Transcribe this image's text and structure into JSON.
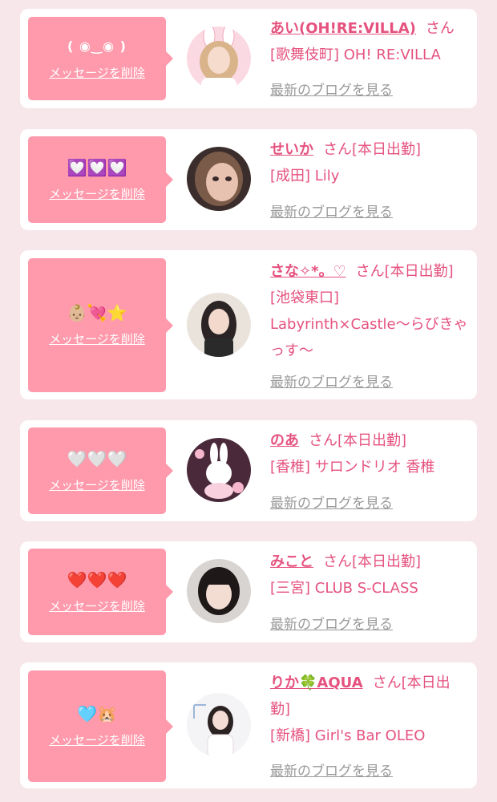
{
  "delete_label": "メッセージを削除",
  "blog_label": "最新のブログを見る",
  "san_suffix": "さん",
  "colors": {
    "background": "#f7e7ea",
    "bubble": "#fe9aac",
    "accent": "#e5527f",
    "link_gray": "#999999"
  },
  "cards": [
    {
      "message": "( ◉‿◉ )",
      "name": "あい(OH!RE:VILLA)",
      "status": "",
      "shop": "[歌舞伎町] OH! RE:VILLA",
      "avatar": "avatar-bunny-ears-girl"
    },
    {
      "message": "💟💟💟",
      "name": "せいか",
      "status": "[本日出勤]",
      "shop": "[成田] Lily",
      "avatar": "avatar-girl-closeup"
    },
    {
      "message": "👶🏼💘⭐️",
      "name": "さな✧*。♡",
      "status": "[本日出勤]",
      "shop": "[池袋東口] Labyrinth×Castle〜らびきゃっす〜",
      "avatar": "avatar-girl-dark-hair"
    },
    {
      "message": "🤍🤍🤍",
      "name": "のあ",
      "status": "[本日出勤]",
      "shop": "[香椎] サロンドリオ 香椎",
      "avatar": "avatar-bunny-plush"
    },
    {
      "message": "❤️❤️❤️",
      "name": "みこと",
      "status": "[本日出勤]",
      "shop": "[三宮] CLUB S-CLASS",
      "avatar": "avatar-girl-bob"
    },
    {
      "message": "🩵🐹",
      "name": "りか🍀AQUA",
      "status": "[本日出勤]",
      "shop": "[新橋] Girl's Bar OLEO",
      "avatar": "avatar-girl-white-outfit"
    }
  ]
}
